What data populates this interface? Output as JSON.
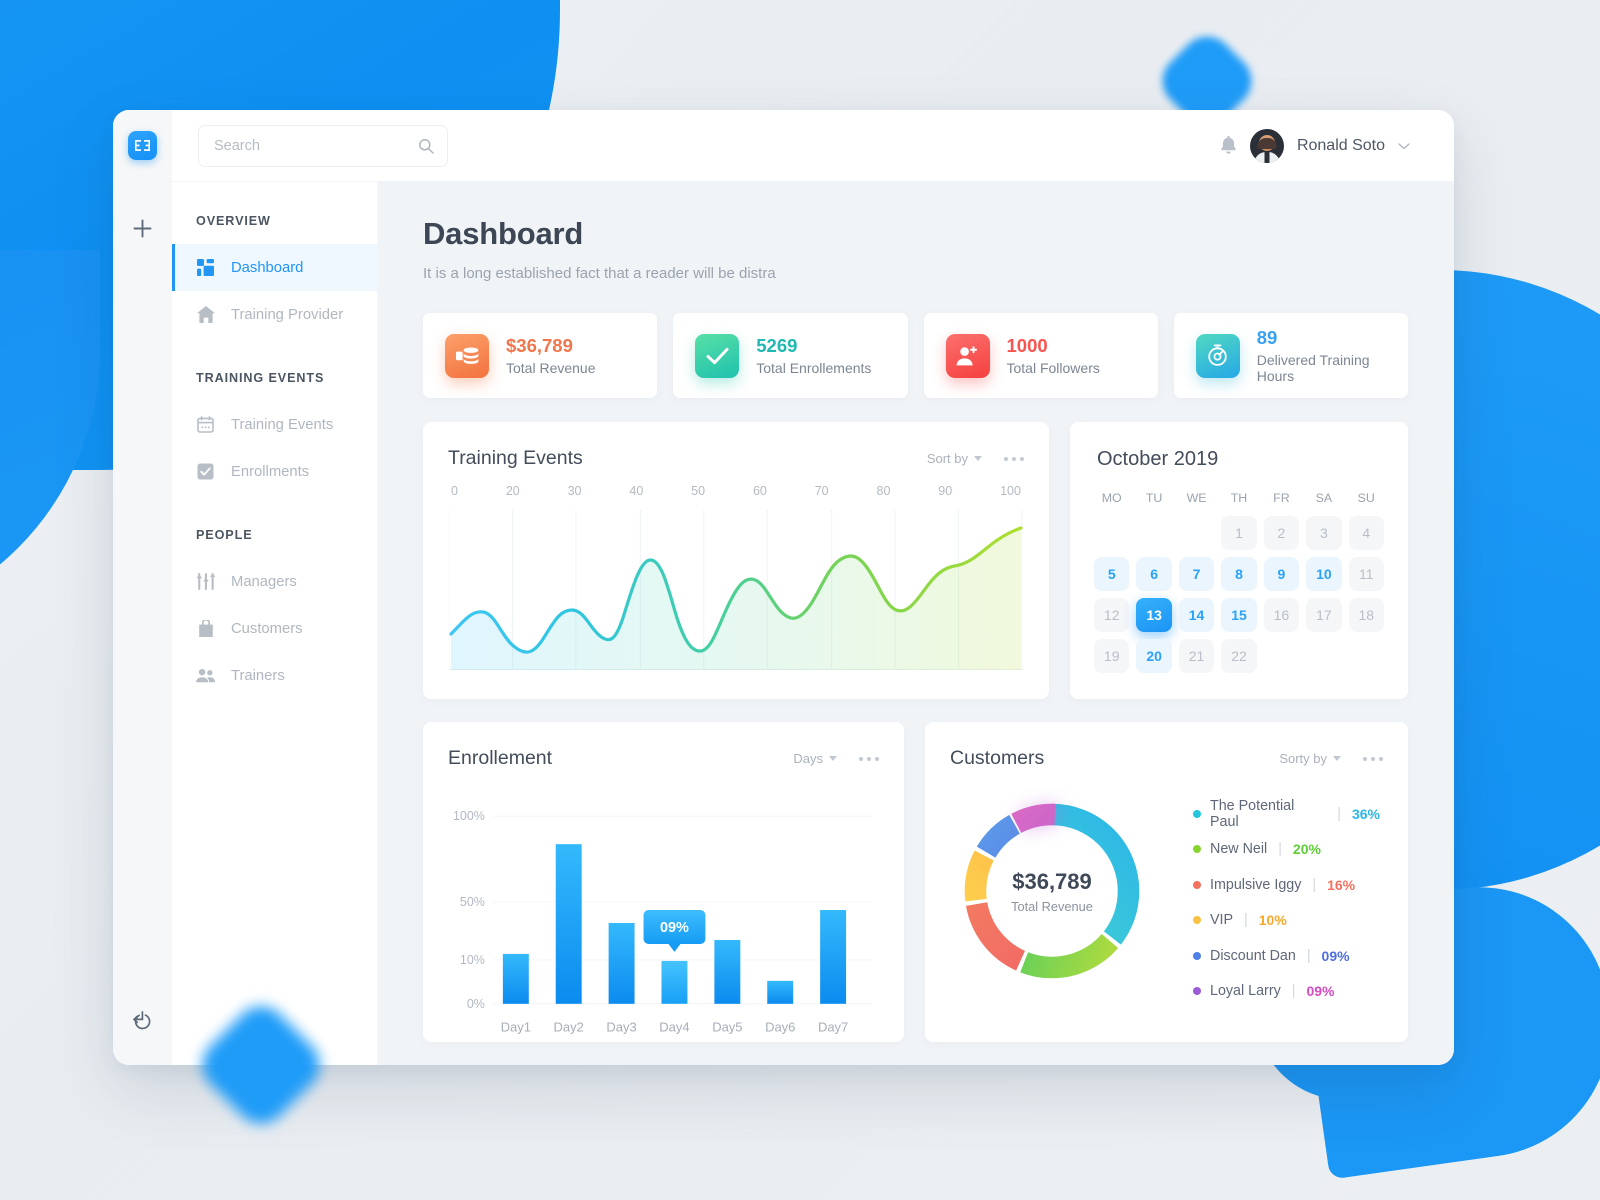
{
  "brand": {
    "logo_text": "E3",
    "accent": "#2196f3"
  },
  "topbar": {
    "search_placeholder": "Search",
    "search_value": "",
    "user_name": "Ronald Soto"
  },
  "sidebar": {
    "sections": [
      {
        "label": "OVERVIEW",
        "items": [
          {
            "label": "Dashboard",
            "icon": "grid-icon",
            "active": true
          },
          {
            "label": "Training Provider",
            "icon": "home-icon",
            "active": false
          }
        ]
      },
      {
        "label": "TRAINING EVENTS",
        "items": [
          {
            "label": "Training Events",
            "icon": "calendar-icon",
            "active": false
          },
          {
            "label": "Enrollments",
            "icon": "check-square-icon",
            "active": false
          }
        ]
      },
      {
        "label": "PEOPLE",
        "items": [
          {
            "label": "Managers",
            "icon": "sliders-icon",
            "active": false
          },
          {
            "label": "Customers",
            "icon": "bag-icon",
            "active": false
          },
          {
            "label": "Trainers",
            "icon": "users-icon",
            "active": false
          }
        ]
      }
    ]
  },
  "page": {
    "title": "Dashboard",
    "subtitle": "It is a long established fact that a reader will be distra"
  },
  "stats": [
    {
      "value": "$36,789",
      "label": "Total Revenue",
      "icon": "coins-icon",
      "color": "#f2764b",
      "grad_from": "#fca06a",
      "grad_to": "#f2723f"
    },
    {
      "value": "5269",
      "label": "Total Enrollements",
      "icon": "check-icon",
      "color": "#28c1a8",
      "grad_from": "#58e0a6",
      "grad_to": "#1fc1ae"
    },
    {
      "value": "1000",
      "label": "Total Followers",
      "icon": "user-plus-icon",
      "color": "#f9544f",
      "grad_from": "#fc706d",
      "grad_to": "#f4403f"
    },
    {
      "value": "89",
      "label": "Delivered Training Hours",
      "icon": "stopwatch-icon",
      "color": "#3aa0f0",
      "grad_from": "#4fd9c0",
      "grad_to": "#27a7e8"
    }
  ],
  "training_events": {
    "title": "Training Events",
    "sort_label": "Sort by",
    "menu_label": "more-options"
  },
  "calendar": {
    "title": "October 2019",
    "dow": [
      "MO",
      "TU",
      "WE",
      "TH",
      "FR",
      "SA",
      "SU"
    ],
    "lead_blanks": 3,
    "days": [
      {
        "n": "1",
        "state": "off"
      },
      {
        "n": "2",
        "state": "off"
      },
      {
        "n": "3",
        "state": "off"
      },
      {
        "n": "4",
        "state": "off"
      },
      {
        "n": "5",
        "state": "hl"
      },
      {
        "n": "6",
        "state": "hl"
      },
      {
        "n": "7",
        "state": "hl"
      },
      {
        "n": "8",
        "state": "hl"
      },
      {
        "n": "9",
        "state": "hl"
      },
      {
        "n": "10",
        "state": "hl"
      },
      {
        "n": "11",
        "state": "off"
      },
      {
        "n": "12",
        "state": "off"
      },
      {
        "n": "13",
        "state": "sel"
      },
      {
        "n": "14",
        "state": "hl"
      },
      {
        "n": "15",
        "state": "hl"
      },
      {
        "n": "16",
        "state": "off"
      },
      {
        "n": "17",
        "state": "off"
      },
      {
        "n": "18",
        "state": "off"
      },
      {
        "n": "19",
        "state": "off"
      },
      {
        "n": "20",
        "state": "hl"
      },
      {
        "n": "21",
        "state": "off"
      },
      {
        "n": "22",
        "state": "off"
      }
    ]
  },
  "enrollment": {
    "title": "Enrollement",
    "filter_label": "Days",
    "menu_label": "more-options",
    "tooltip": "09%"
  },
  "customers": {
    "title": "Customers",
    "sort_label": "Sorty by",
    "menu_label": "more-options",
    "center_value": "$36,789",
    "center_label": "Total Revenue"
  },
  "chart_data": [
    {
      "type": "area",
      "title": "Training Events",
      "xlabel": "",
      "ylabel": "",
      "grid": true,
      "legend": "none",
      "tick_labels": [
        "0",
        "20",
        "30",
        "40",
        "50",
        "60",
        "70",
        "80",
        "90",
        "100"
      ],
      "x": [
        0,
        5,
        11,
        17,
        22,
        27,
        32,
        37,
        41,
        45,
        50,
        54,
        58,
        63,
        68,
        73,
        78,
        83,
        88,
        93,
        100
      ],
      "values": [
        20,
        32,
        27,
        12,
        18,
        33,
        30,
        19,
        28,
        62,
        58,
        22,
        8,
        35,
        52,
        48,
        36,
        48,
        72,
        66,
        50,
        62,
        74,
        80
      ],
      "series": [
        {
          "name": "Events",
          "points": [
            20,
            33,
            26,
            11,
            17,
            34,
            31,
            18,
            27,
            63,
            57,
            21,
            7,
            36,
            53,
            47,
            35,
            49,
            73,
            65,
            51,
            63,
            75,
            82
          ]
        }
      ],
      "color_start": "#35bdf6",
      "color_end": "#a4d93a"
    },
    {
      "type": "bar",
      "title": "Enrollement",
      "categories": [
        "Day1",
        "Day2",
        "Day3",
        "Day4",
        "Day5",
        "Day6",
        "Day7"
      ],
      "values": [
        14,
        85,
        32,
        9,
        21,
        4,
        41
      ],
      "ylabel": "",
      "xlabel": "",
      "ytick_labels": [
        "0%",
        "10%",
        "50%",
        "100%"
      ],
      "ytick_values": [
        0,
        10,
        50,
        100
      ],
      "ylim": [
        0,
        100
      ],
      "grid": true,
      "highlight_index": 3,
      "highlight_label": "09%",
      "bar_color_from": "#32b6fb",
      "bar_color_to": "#108bef"
    },
    {
      "type": "pie",
      "title": "Customers",
      "center_value": "$36,789",
      "center_label": "Total Revenue",
      "legend": "right",
      "labels": [
        "The Potential Paul",
        "New Neil",
        "Impulsive Iggy",
        "VIP",
        "Discount Dan",
        "Loyal Larry"
      ],
      "values": [
        36,
        20,
        16,
        10,
        9,
        9
      ],
      "display_values": [
        "36%",
        "20%",
        "16%",
        "10%",
        "09%",
        "09%"
      ],
      "colors": [
        "#23c6db",
        "#87d42f",
        "#f4705f",
        "#fac141",
        "#4f7fe8",
        "#9b5ad6"
      ],
      "pct_text_colors": [
        "#2ab6e8",
        "#5fce36",
        "#f4705f",
        "#f7a82a",
        "#4f6fe0",
        "#d44bc4"
      ]
    }
  ]
}
